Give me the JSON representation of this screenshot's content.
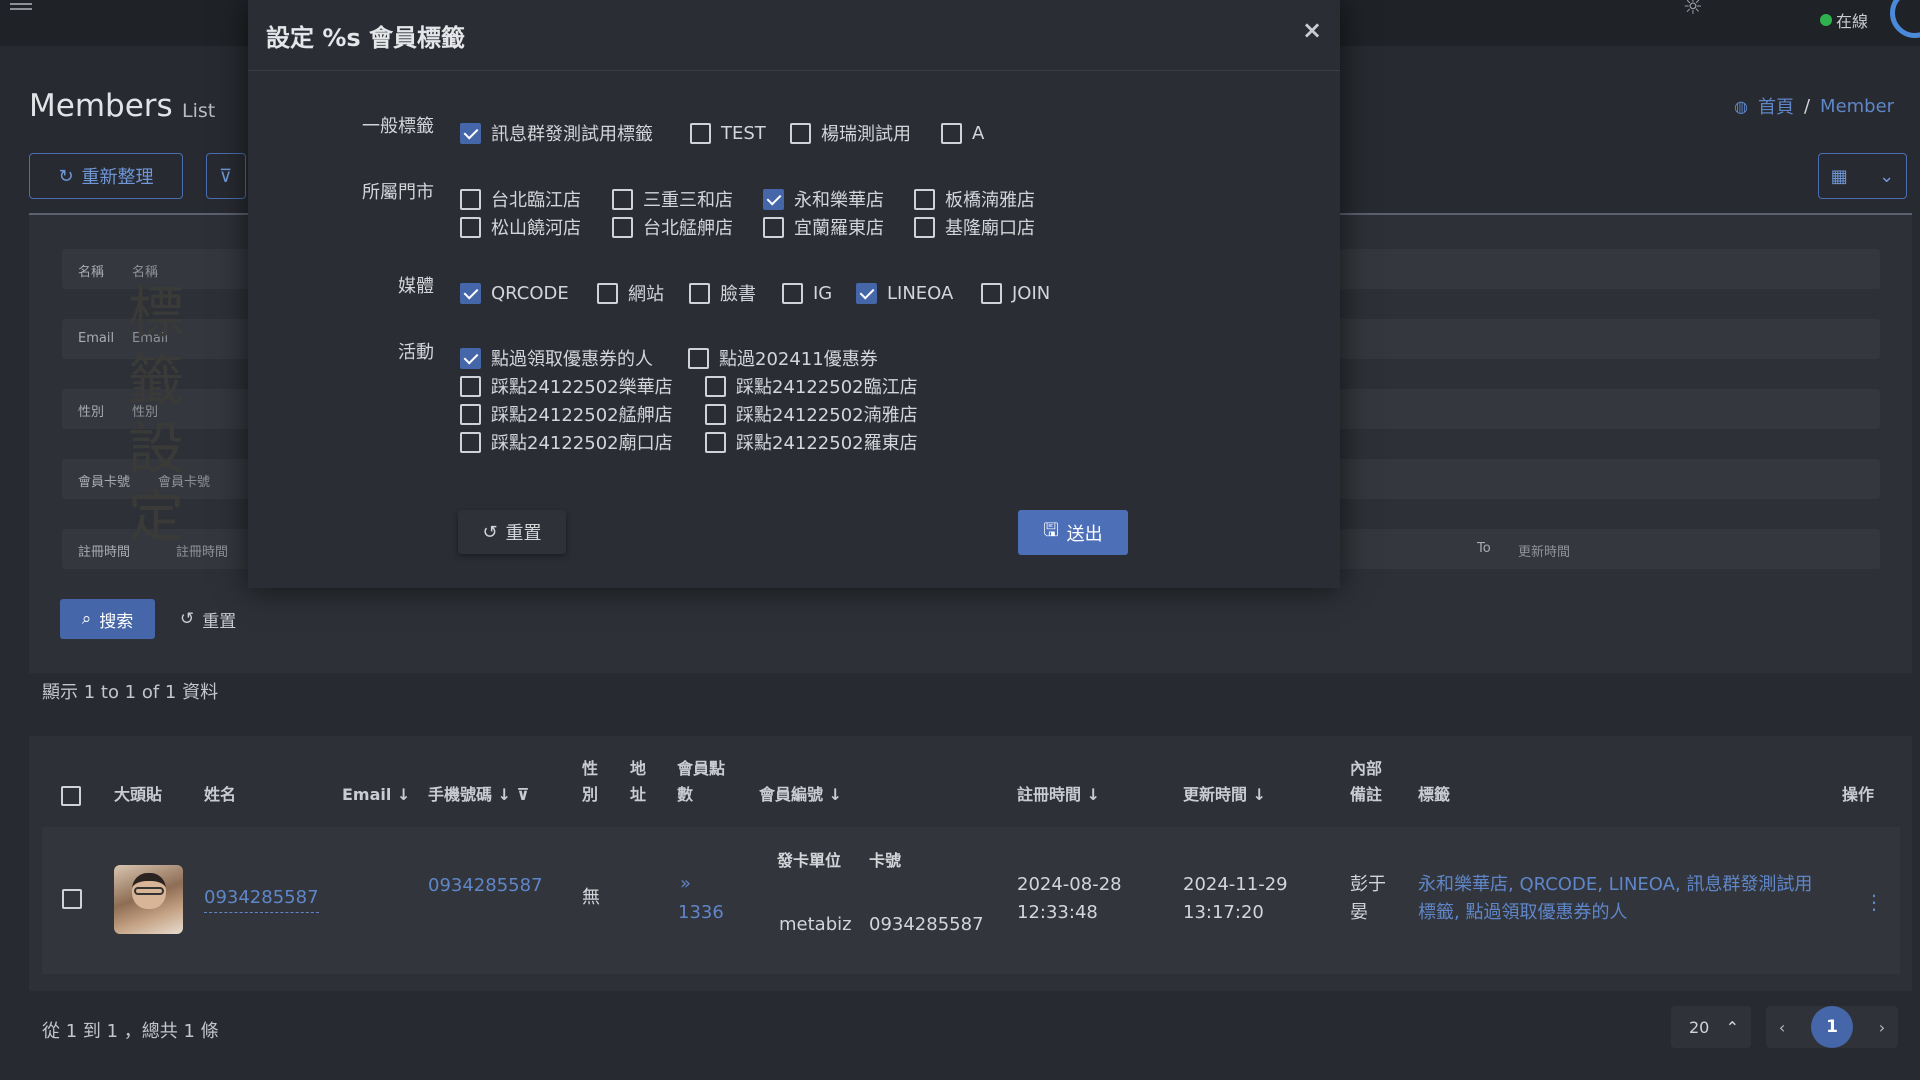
{
  "topbar": {
    "online_label": "在線"
  },
  "page": {
    "title": "Members",
    "subtitle": "List"
  },
  "breadcrumb": {
    "home": "首頁",
    "separator": "/",
    "current": "Member"
  },
  "toolbar": {
    "refresh_label": "重新整理"
  },
  "filters": [
    {
      "label": "名稱",
      "placeholder": "名稱"
    },
    {
      "label": "Email",
      "placeholder": "Email"
    },
    {
      "label": "性別",
      "placeholder": "性別"
    },
    {
      "label": "會員卡號",
      "placeholder": "會員卡號"
    },
    {
      "label": "註冊時間",
      "placeholder": "註冊時間",
      "to_label": "To",
      "placeholder2": "更新時間"
    }
  ],
  "filter_actions": {
    "search": "搜索",
    "reset": "重置"
  },
  "showing_text": "顯示 1 to 1 of 1 資料",
  "table": {
    "headers": {
      "avatar": "大頭貼",
      "name": "姓名",
      "email": "Email",
      "phone": "手機號碼",
      "gender": "性\n別",
      "address": "地\n址",
      "points": "會員點\n數",
      "member_no": "會員編號",
      "reg_time": "註冊時間",
      "upd_time": "更新時間",
      "note": "內部\n備註",
      "tags": "標籤",
      "actions": "操作"
    },
    "row": {
      "name": "0934285587",
      "phone": "0934285587",
      "gender": "無",
      "points_prefix": "»",
      "points": "1336",
      "card_unit_label": "發卡單位",
      "card_no_label": "卡號",
      "card_unit": "metabiz",
      "card_no": "0934285587",
      "reg_date": "2024-08-28",
      "reg_clock": "12:33:48",
      "upd_date": "2024-11-29",
      "upd_clock": "13:17:20",
      "note": "彭于\n晏",
      "tags": "永和樂華店, QRCODE, LINEOA, 訊息群發測試用標籤, 點過領取優惠券的人"
    }
  },
  "pagination": {
    "summary": "從 1 到 1 ，總共 1 條",
    "page_size": "20",
    "current_page": "1"
  },
  "watermark": "標籤設定",
  "modal": {
    "title": "設定 %s 會員標籤",
    "close": "×",
    "groups": {
      "general": {
        "label": "一般標籤",
        "options": [
          {
            "text": "訊息群發測試用標籤",
            "checked": true
          },
          {
            "text": "TEST",
            "checked": false
          },
          {
            "text": "楊瑞測試用",
            "checked": false
          },
          {
            "text": "A",
            "checked": false
          }
        ]
      },
      "stores": {
        "label": "所屬門市",
        "options": [
          {
            "text": "台北臨江店",
            "checked": false
          },
          {
            "text": "三重三和店",
            "checked": false
          },
          {
            "text": "永和樂華店",
            "checked": true
          },
          {
            "text": "板橋湳雅店",
            "checked": false
          },
          {
            "text": "松山饒河店",
            "checked": false
          },
          {
            "text": "台北艋舺店",
            "checked": false
          },
          {
            "text": "宜蘭羅東店",
            "checked": false
          },
          {
            "text": "基隆廟口店",
            "checked": false
          }
        ]
      },
      "media": {
        "label": "媒體",
        "options": [
          {
            "text": "QRCODE",
            "checked": true
          },
          {
            "text": "網站",
            "checked": false
          },
          {
            "text": "臉書",
            "checked": false
          },
          {
            "text": "IG",
            "checked": false
          },
          {
            "text": "LINEOA",
            "checked": true
          },
          {
            "text": "JOIN",
            "checked": false
          }
        ]
      },
      "events": {
        "label": "活動",
        "options": [
          {
            "text": "點過領取優惠券的人",
            "checked": true
          },
          {
            "text": "點過202411優惠券",
            "checked": false
          },
          {
            "text": "踩點24122502樂華店",
            "checked": false
          },
          {
            "text": "踩點24122502臨江店",
            "checked": false
          },
          {
            "text": "踩點24122502艋舺店",
            "checked": false
          },
          {
            "text": "踩點24122502湳雅店",
            "checked": false
          },
          {
            "text": "踩點24122502廟口店",
            "checked": false
          },
          {
            "text": "踩點24122502羅東店",
            "checked": false
          }
        ]
      }
    },
    "reset_label": "重置",
    "submit_label": "送出"
  },
  "colors": {
    "accent": "#4566a8",
    "link": "#5f86c8",
    "online": "#2fb34f"
  },
  "icons": [
    "menu-icon",
    "sun-icon",
    "refresh-icon",
    "filter-icon",
    "grid-icon",
    "search-icon",
    "undo-icon",
    "save-icon",
    "close-icon",
    "dashboard-icon"
  ]
}
